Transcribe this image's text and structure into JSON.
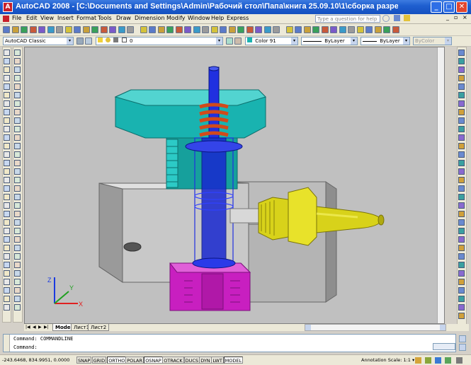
{
  "window": {
    "title": "AutoCAD 2008 - [C:\\Documents and Settings\\Admin\\Рабочий стол\\Папа\\книга 25.09.10\\1\\сборка разрез готовый цвет.dwg]",
    "app_icon_glyph": "A",
    "minimize_glyph": "_",
    "maximize_glyph": "□",
    "close_glyph": "✕"
  },
  "menubar": {
    "items": [
      "File",
      "Edit",
      "View",
      "Insert",
      "Format",
      "Tools",
      "Draw",
      "Dimension",
      "Modify",
      "Window",
      "Help",
      "Express"
    ],
    "help_placeholder": "Type a question for help",
    "doc_minimize_glyph": "_",
    "doc_restore_glyph": "▫",
    "doc_close_glyph": "×"
  },
  "toolbar": {
    "workspace": "AutoCAD Classic",
    "layer": "0",
    "color": "Color 91",
    "linetype": "ByLayer",
    "lineweight": "ByLayer",
    "plotstyle": "ByColor",
    "dropdown_glyph": "▾"
  },
  "tabs": {
    "nav_glyphs": [
      "|◀",
      "◀",
      "▶",
      "▶|"
    ],
    "items": [
      "Model",
      "Лист1",
      "Лист2"
    ],
    "active": "Model"
  },
  "command_lines": [
    "Command:  COMMANDLINE",
    "Command:"
  ],
  "statusbar": {
    "coords": "-243.6468, 834.9951, 0.0000",
    "buttons": [
      "SNAP",
      "GRID",
      "ORTHO",
      "POLAR",
      "OSNAP",
      "OTRACK",
      "DUCS",
      "DYN",
      "LWT",
      "MODEL"
    ],
    "active_buttons": [
      "ORTHO",
      "OSNAP",
      "MODEL"
    ],
    "annotation_scale": "Annotation Scale:  1:1 ▾"
  },
  "ucs": {
    "x_label": "X",
    "y_label": "Y",
    "z_label": "Z"
  },
  "colors": {
    "cyan_nut": "#19b3b0",
    "orange_spring": "#d24a1a",
    "blue_stem": "#2030e0",
    "magenta_base": "#c81fc0",
    "yellow_fitting": "#d8d21a",
    "gray_body": "#c8c8c8",
    "viewport_bg": "#c0c0c0"
  }
}
